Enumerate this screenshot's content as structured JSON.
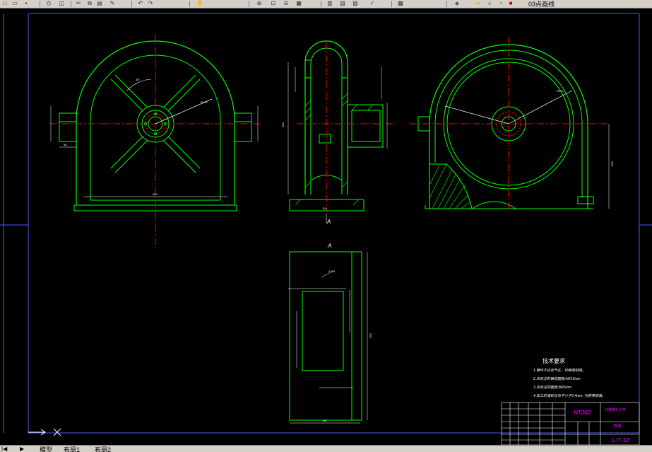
{
  "toolbar": {
    "layer_name": "03点画线",
    "icons": [
      "new-icon",
      "open-icon",
      "save-icon",
      "print-icon",
      "preview-icon",
      "cut-icon",
      "copy-icon",
      "paste-icon",
      "match-icon",
      "undo-icon",
      "redo-icon",
      "pan-icon",
      "zoom-realtime-icon",
      "zoom-window-icon",
      "zoom-previous-icon",
      "properties-icon",
      "design-center-icon",
      "tool-palette-icon",
      "sheet-set-icon",
      "markup-icon",
      "calc-icon",
      "layer-manager-icon",
      "layer-bulb-icon",
      "layer-sun-icon",
      "layer-lock-icon",
      "layer-color-icon"
    ]
  },
  "drawing": {
    "section_label": "A",
    "view_label": "A",
    "tech_title": "技术要求",
    "tech_lines": [
      "1.铸件不应有气孔、砂眼等缺陷。",
      "2.未标注的铸造圆角为R10mm",
      "3.未标注的圆角为R5mm",
      "4.加工的滑轮应有不小于0.4mm, 毛刺等锐角。"
    ],
    "title_block": {
      "material": "HT200",
      "school": "江西理工大学",
      "part_name": "机架",
      "drawing_no": "LJT-12"
    },
    "dims": {
      "front_width": "380",
      "front_angle": "45°",
      "front_radius": "R170",
      "front_small_1": "38",
      "side_height": "460",
      "side_base": "120",
      "right_diameter": "R170",
      "right_height": "350",
      "view_a_width": "180",
      "view_a_height": "350",
      "view_a_note": "2-Φ5"
    }
  },
  "layout_tabs": [
    "模型",
    "布局1",
    "布局2"
  ],
  "colors": {
    "background": "#000000",
    "outline": "#00ff00",
    "center": "#ff0000",
    "dim": "#ffffff",
    "frame": "#4a5cff",
    "title_text": "#ff00ff"
  }
}
